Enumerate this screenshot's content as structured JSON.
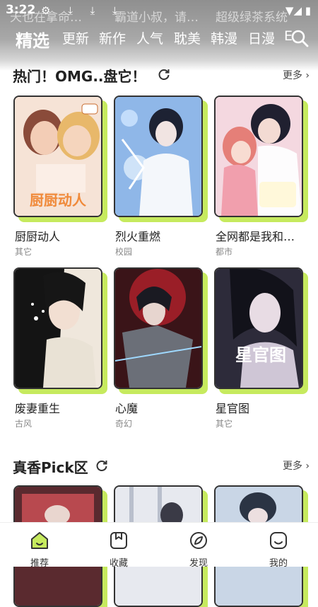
{
  "statusbar": {
    "time": "3:22",
    "icons": "⚙ ⤓ ⤓ ⤓",
    "right": "▼◢ ▮"
  },
  "ticker": [
    "天也在拿命…",
    "霸道小叔，请…",
    "超级绿茶系统"
  ],
  "tabs": [
    {
      "label": "精选",
      "active": true
    },
    {
      "label": "更新"
    },
    {
      "label": "新作"
    },
    {
      "label": "人气"
    },
    {
      "label": "耽美"
    },
    {
      "label": "韩漫"
    },
    {
      "label": "日漫"
    },
    {
      "label": "E"
    }
  ],
  "sections": [
    {
      "title": "热门！OMG..盘它！",
      "more": "更多",
      "items": [
        {
          "title": "厨厨动人",
          "tag": "其它",
          "cover_text": "厨厨动人"
        },
        {
          "title": "烈火重燃",
          "tag": "校园"
        },
        {
          "title": "全网都是我和…",
          "tag": "都市"
        },
        {
          "title": "废妻重生",
          "tag": "古风"
        },
        {
          "title": "心魔",
          "tag": "奇幻"
        },
        {
          "title": "星官图",
          "tag": "其它",
          "cover_text": "星官图"
        }
      ]
    },
    {
      "title": "真香Pick区",
      "more": "更多"
    }
  ],
  "bottom_nav": [
    {
      "label": "推荐",
      "icon": "home-icon",
      "active": true
    },
    {
      "label": "收藏",
      "icon": "bookmark-icon"
    },
    {
      "label": "发现",
      "icon": "compass-icon"
    },
    {
      "label": "我的",
      "icon": "profile-icon"
    }
  ],
  "colors": {
    "accent": "#c6ea5e",
    "border": "#333333"
  }
}
